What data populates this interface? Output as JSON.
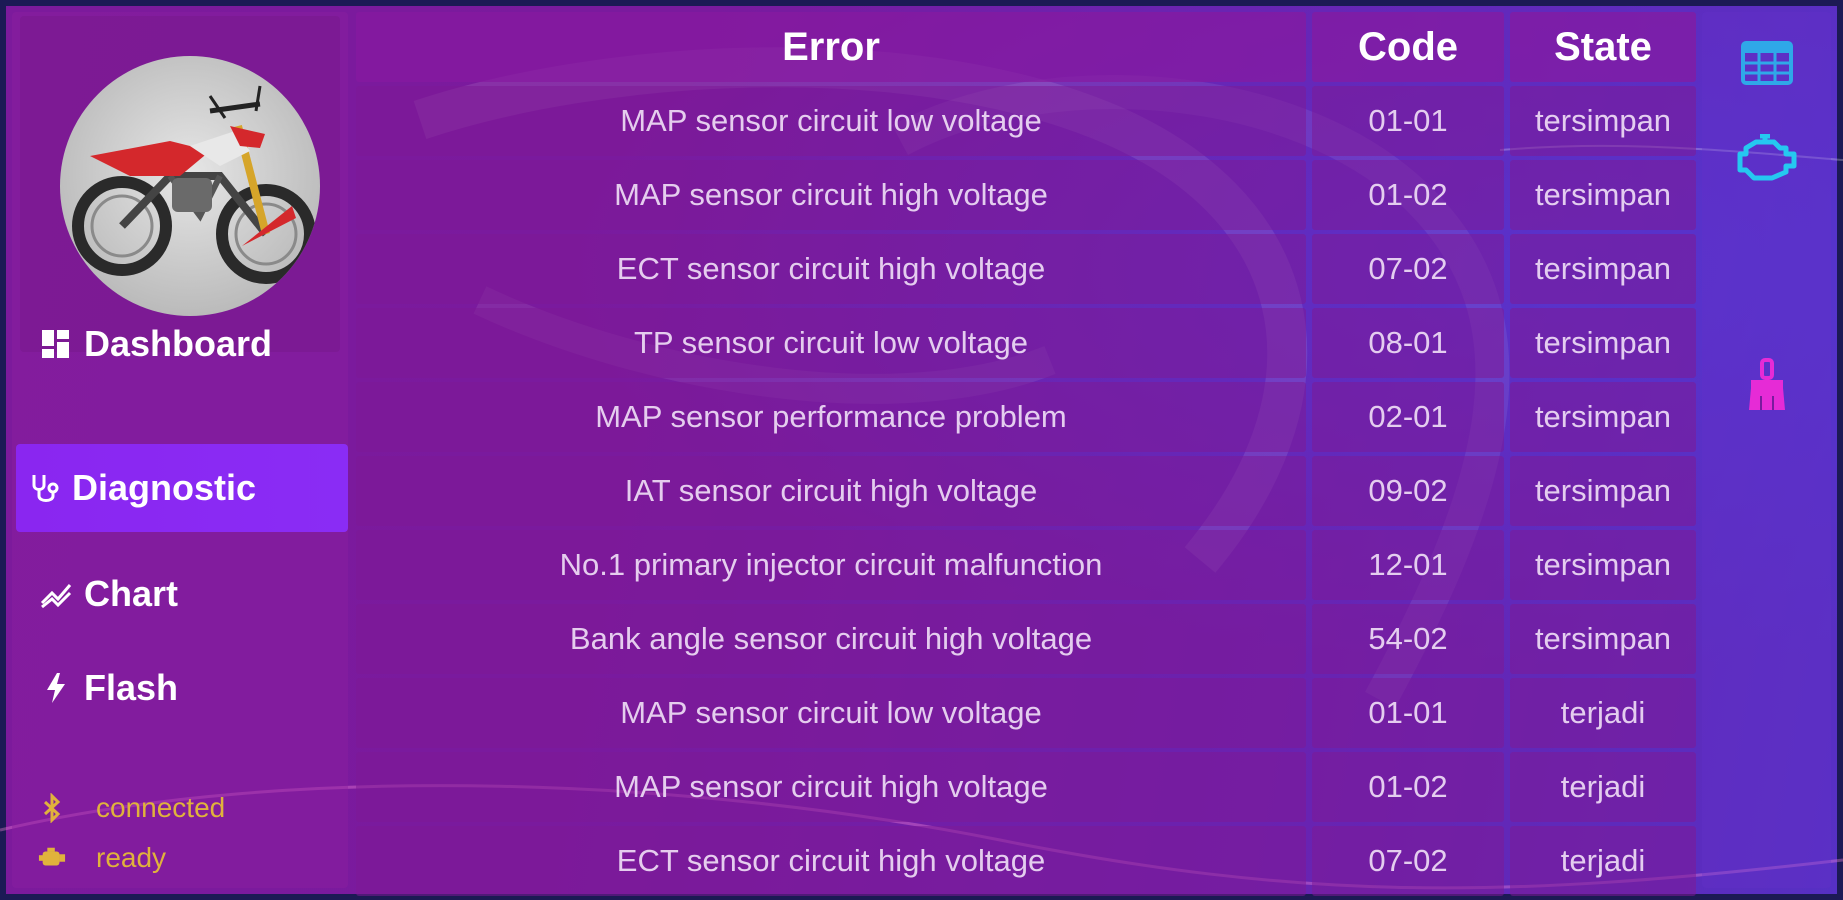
{
  "sidebar": {
    "nav": [
      {
        "label": "Dashboard",
        "icon": "dashboard-icon"
      },
      {
        "label": "Diagnostic",
        "icon": "stethoscope-icon"
      },
      {
        "label": "Chart",
        "icon": "chart-icon"
      },
      {
        "label": "Flash",
        "icon": "flash-icon"
      }
    ],
    "active_index": 1,
    "status": [
      {
        "text": "connected",
        "icon": "bluetooth-icon"
      },
      {
        "text": "ready",
        "icon": "engine-status-icon"
      }
    ]
  },
  "table": {
    "headers": {
      "error": "Error",
      "code": "Code",
      "state": "State"
    },
    "rows": [
      {
        "error": "MAP sensor circuit low voltage",
        "code": "01-01",
        "state": "tersimpan"
      },
      {
        "error": "MAP sensor circuit high voltage",
        "code": "01-02",
        "state": "tersimpan"
      },
      {
        "error": "ECT sensor circuit high voltage",
        "code": "07-02",
        "state": "tersimpan"
      },
      {
        "error": "TP sensor circuit low voltage",
        "code": "08-01",
        "state": "tersimpan"
      },
      {
        "error": "MAP sensor performance problem",
        "code": "02-01",
        "state": "tersimpan"
      },
      {
        "error": "IAT sensor circuit high voltage",
        "code": "09-02",
        "state": "tersimpan"
      },
      {
        "error": "No.1 primary injector circuit malfunction",
        "code": "12-01",
        "state": "tersimpan"
      },
      {
        "error": "Bank angle sensor circuit high voltage",
        "code": "54-02",
        "state": "tersimpan"
      },
      {
        "error": "MAP sensor circuit low voltage",
        "code": "01-01",
        "state": "terjadi"
      },
      {
        "error": "MAP sensor circuit high voltage",
        "code": "01-02",
        "state": "terjadi"
      },
      {
        "error": "ECT sensor circuit high voltage",
        "code": "07-02",
        "state": "terjadi"
      }
    ]
  },
  "toolbar": [
    {
      "icon": "table-view-icon",
      "color": "#2fa8e8"
    },
    {
      "icon": "check-engine-icon",
      "color": "#25c8f0"
    },
    {
      "icon": "clear-brush-icon",
      "color": "#e62bd6"
    }
  ],
  "colors": {
    "accent": "#8a2cf5",
    "status_text": "#e0b23c"
  }
}
